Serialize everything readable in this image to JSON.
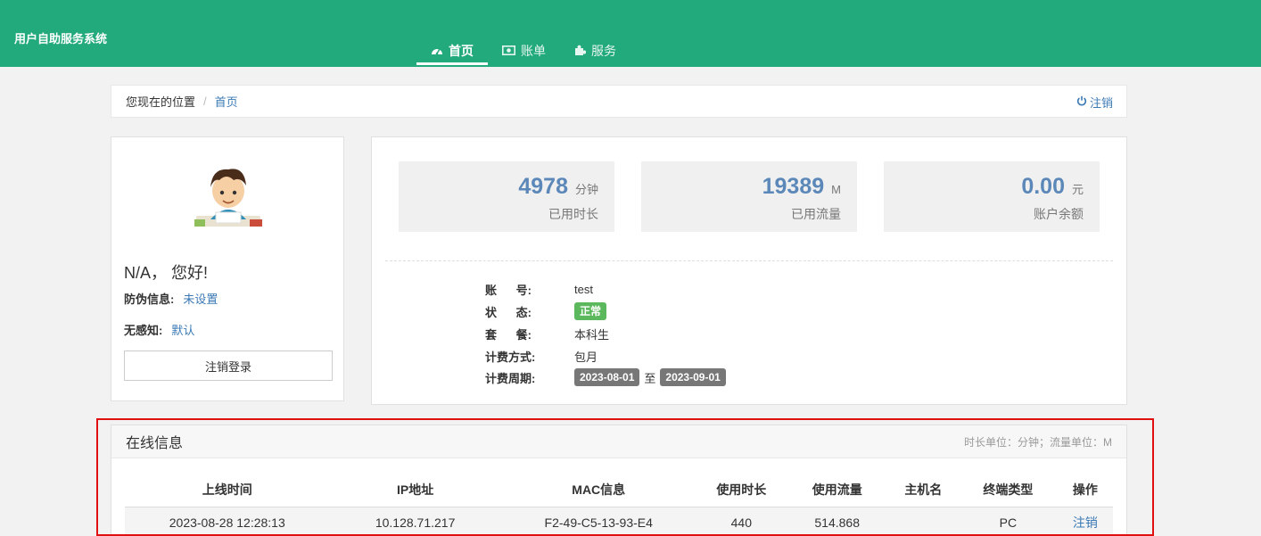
{
  "app": {
    "title": "用户自助服务系统"
  },
  "nav": {
    "items": [
      {
        "label": "首页",
        "icon": "dashboard-icon",
        "active": true
      },
      {
        "label": "账单",
        "icon": "money-icon",
        "active": false
      },
      {
        "label": "服务",
        "icon": "puzzle-icon",
        "active": false
      }
    ]
  },
  "breadcrumb": {
    "prefix": "您现在的位置",
    "current": "首页",
    "logout": "注销"
  },
  "user": {
    "greeting": "N/A，  您好!",
    "anti_phishing_label": "防伪信息:",
    "anti_phishing_value": "未设置",
    "seamless_label": "无感知:",
    "seamless_value": "默认",
    "logout_button": "注销登录"
  },
  "stats": [
    {
      "value": "4978",
      "unit": "分钟",
      "label": "已用时长"
    },
    {
      "value": "19389",
      "unit": "M",
      "label": "已用流量"
    },
    {
      "value": "0.00",
      "unit": "元",
      "label": "账户余额"
    }
  ],
  "account": {
    "id_label": "账      号:",
    "id_value": "test",
    "status_label": "状      态:",
    "status_value": "正常",
    "plan_label": "套      餐:",
    "plan_value": "本科生",
    "billing_label": "计费方式:",
    "billing_value": "包月",
    "period_label": "计费周期:",
    "period_start": "2023-08-01",
    "period_to": "至",
    "period_end": "2023-09-01"
  },
  "online": {
    "title": "在线信息",
    "note": "时长单位：分钟；流量单位：M",
    "columns": [
      "上线时间",
      "IP地址",
      "MAC信息",
      "使用时长",
      "使用流量",
      "主机名",
      "终端类型",
      "操作"
    ],
    "rows": [
      [
        "2023-08-28 12:28:13",
        "10.128.71.217",
        "F2-49-C5-13-93-E4",
        "440",
        "514.868",
        "",
        "PC",
        "注销"
      ]
    ]
  },
  "colors": {
    "header": "#22a97c",
    "link": "#3b7ab5",
    "stat_number": "#5b88b8",
    "ok_badge": "#5cb85c",
    "highlight": "#e01010"
  }
}
